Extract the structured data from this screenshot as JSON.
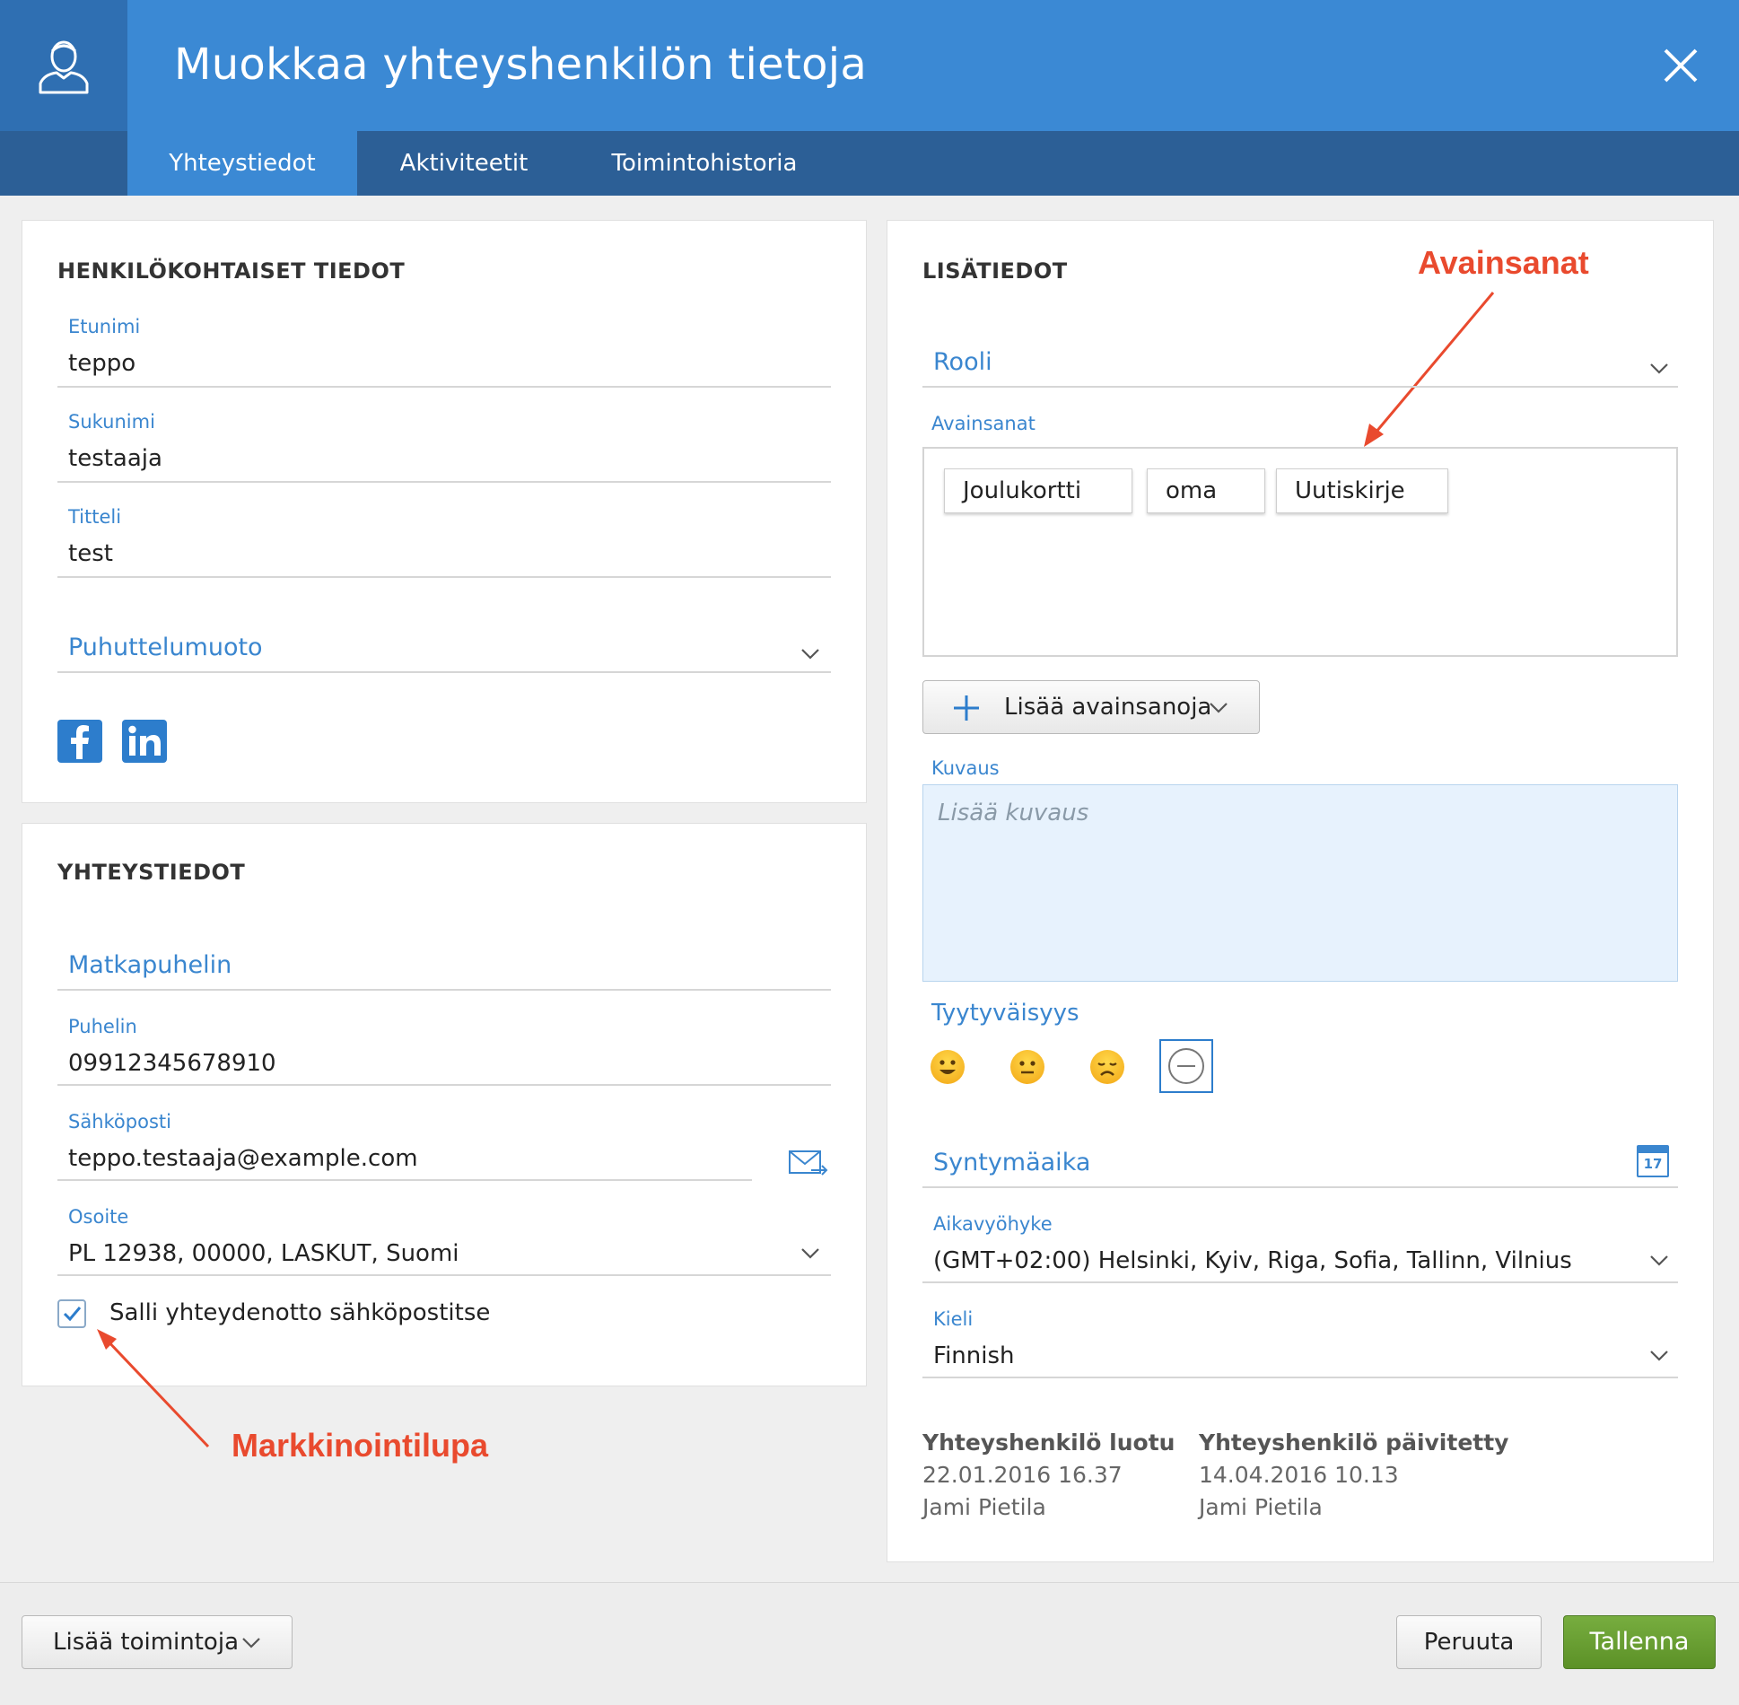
{
  "dialog": {
    "title": "Muokkaa yhteyshenkilön tietoja"
  },
  "tabs": [
    {
      "label": "Yhteystiedot"
    },
    {
      "label": "Aktiviteetit"
    },
    {
      "label": "Toimintohistoria"
    }
  ],
  "personal": {
    "heading": "HENKILÖKOHTAISET TIEDOT",
    "first_name": {
      "label": "Etunimi",
      "value": "teppo"
    },
    "last_name": {
      "label": "Sukunimi",
      "value": "testaaja"
    },
    "title": {
      "label": "Titteli",
      "value": "test"
    },
    "salutation": {
      "placeholder": "Puhuttelumuoto"
    }
  },
  "contact": {
    "heading": "YHTEYSTIEDOT",
    "mobile": {
      "placeholder": "Matkapuhelin"
    },
    "phone": {
      "label": "Puhelin",
      "value": "09912345678910"
    },
    "email": {
      "label": "Sähköposti",
      "value": "teppo.testaaja@example.com"
    },
    "address": {
      "label": "Osoite",
      "value": "PL 12938, 00000, LASKUT, Suomi"
    },
    "allow_email": {
      "label": "Salli yhteydenotto sähköpostitse",
      "checked": true
    }
  },
  "extra": {
    "heading": "LISÄTIEDOT",
    "role": {
      "placeholder": "Rooli"
    },
    "keywords": {
      "label": "Avainsanat",
      "items": [
        "Joulukortti",
        "oma",
        "Uutiskirje"
      ],
      "add_button": "Lisää avainsanoja"
    },
    "description": {
      "label": "Kuvaus",
      "placeholder": "Lisää kuvaus"
    },
    "satisfaction": {
      "label": "Tyytyväisyys",
      "options": [
        "happy",
        "neutral",
        "sad",
        "none"
      ],
      "selected": "none"
    },
    "birthday": {
      "placeholder": "Syntymäaika",
      "calendar_day": "17"
    },
    "timezone": {
      "label": "Aikavyöhyke",
      "value": "(GMT+02:00) Helsinki, Kyiv, Riga, Sofia, Tallinn, Vilnius"
    },
    "language": {
      "label": "Kieli",
      "value": "Finnish"
    }
  },
  "meta": {
    "created_heading": "Yhteyshenkilö luotu",
    "created_date": "22.01.2016 16.37",
    "created_by": "Jami Pietila",
    "updated_heading": "Yhteyshenkilö päivitetty",
    "updated_date": "14.04.2016 10.13",
    "updated_by": "Jami Pietila"
  },
  "annotations": {
    "keywords": "Avainsanat",
    "marketing": "Markkinointilupa"
  },
  "footer": {
    "more_actions": "Lisää toimintoja",
    "cancel": "Peruuta",
    "save": "Tallenna"
  },
  "colors": {
    "header": "#3b89d4",
    "tabs": "#2c5f96",
    "accent": "#3a86cf",
    "annotation": "#e94a2e",
    "save": "#5c9127"
  }
}
